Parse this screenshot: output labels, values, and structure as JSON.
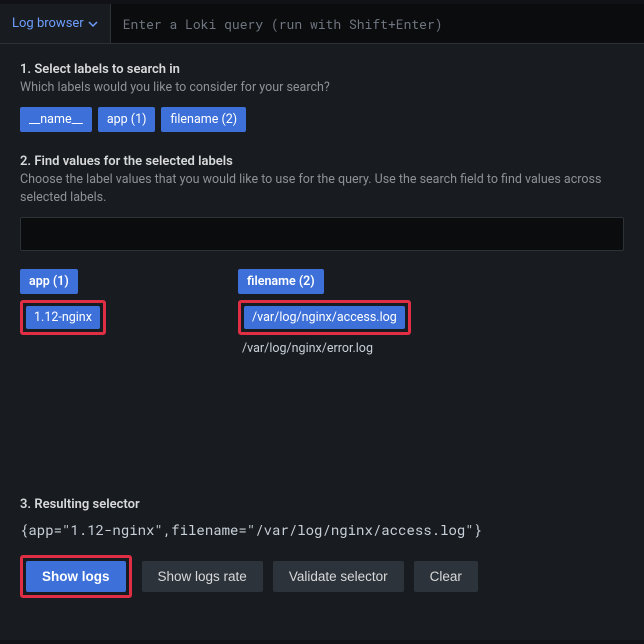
{
  "topbar": {
    "browser_label": "Log browser",
    "query_placeholder": "Enter a Loki query (run with Shift+Enter)"
  },
  "step1": {
    "title": "1. Select labels to search in",
    "desc": "Which labels would you like to consider for your search?",
    "labels": [
      "__name__",
      "app (1)",
      "filename (2)"
    ]
  },
  "step2": {
    "title": "2. Find values for the selected labels",
    "desc": "Choose the label values that you would like to use for the query. Use the search field to find values across selected labels.",
    "col_app": {
      "header": "app (1)",
      "selected": "1.12-nginx"
    },
    "col_filename": {
      "header": "filename (2)",
      "selected": "/var/log/nginx/access.log",
      "other": "/var/log/nginx/error.log"
    }
  },
  "step3": {
    "title": "3. Resulting selector",
    "selector": "{app=\"1.12-nginx\",filename=\"/var/log/nginx/access.log\"}"
  },
  "actions": {
    "show_logs": "Show logs",
    "show_logs_rate": "Show logs rate",
    "validate": "Validate selector",
    "clear": "Clear"
  }
}
